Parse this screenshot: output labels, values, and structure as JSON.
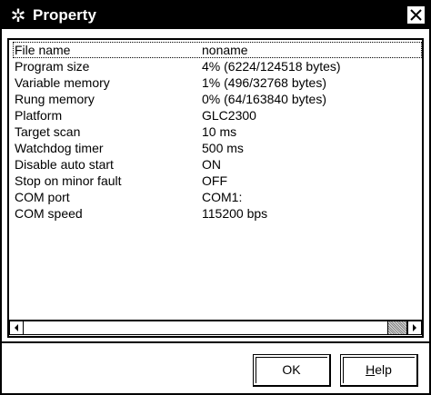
{
  "window": {
    "title": "Property",
    "title_icon": "gear-icon",
    "close_icon": "close-icon"
  },
  "properties": [
    {
      "name": "File name",
      "value": "noname"
    },
    {
      "name": "Program size",
      "value": "4% (6224/124518 bytes)"
    },
    {
      "name": "Variable memory",
      "value": "1% (496/32768 bytes)"
    },
    {
      "name": "Rung memory",
      "value": "0% (64/163840 bytes)"
    },
    {
      "name": "Platform",
      "value": "GLC2300"
    },
    {
      "name": "Target scan",
      "value": "10 ms"
    },
    {
      "name": "Watchdog timer",
      "value": "500 ms"
    },
    {
      "name": "Disable auto start",
      "value": "ON"
    },
    {
      "name": "Stop on minor fault",
      "value": "OFF"
    },
    {
      "name": "COM port",
      "value": "COM1:"
    },
    {
      "name": "COM speed",
      "value": "115200 bps"
    }
  ],
  "buttons": {
    "ok_label": "OK",
    "help_mnemonic": "H",
    "help_rest": "elp"
  }
}
